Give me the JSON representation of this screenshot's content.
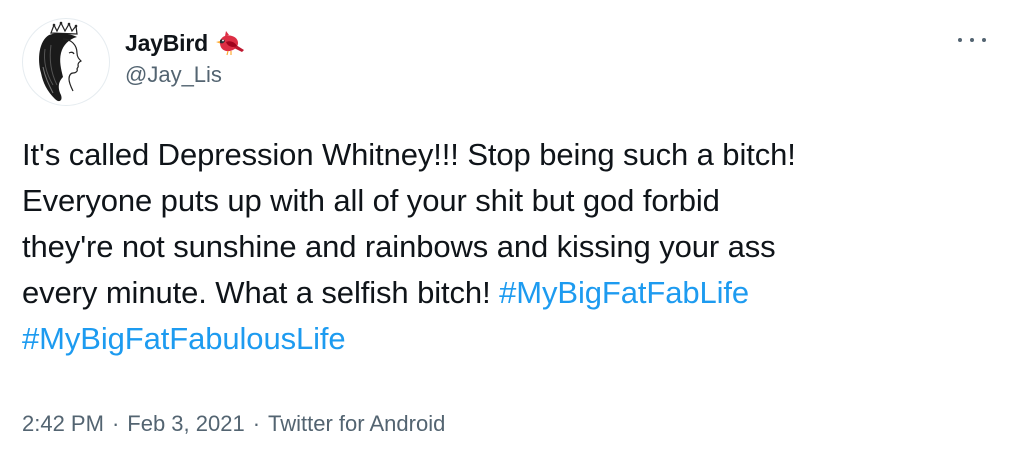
{
  "tweet": {
    "author": {
      "display_name": "JayBird",
      "handle": "@Jay_Lis",
      "avatar_icon": "woman-crown-sketch-avatar",
      "name_emoji_icon": "red-bird-icon"
    },
    "more_icon": "more-horizontal-icon",
    "body": {
      "line1": "It's called Depression Whitney!!! Stop being such a bitch!",
      "line2": "Everyone puts up with all of your shit but god forbid",
      "line3": "they're not sunshine and rainbows and kissing your ass",
      "line4_text": "every minute. What a selfish bitch! ",
      "hashtag1": "#MyBigFatFabLife",
      "hashtag2": "#MyBigFatFabulousLife"
    },
    "meta": {
      "time": "2:42 PM",
      "separator": "·",
      "date": "Feb 3, 2021",
      "source": "Twitter for Android"
    },
    "colors": {
      "link": "#1d9bf0",
      "text": "#0f1419",
      "secondary": "#536471"
    }
  }
}
